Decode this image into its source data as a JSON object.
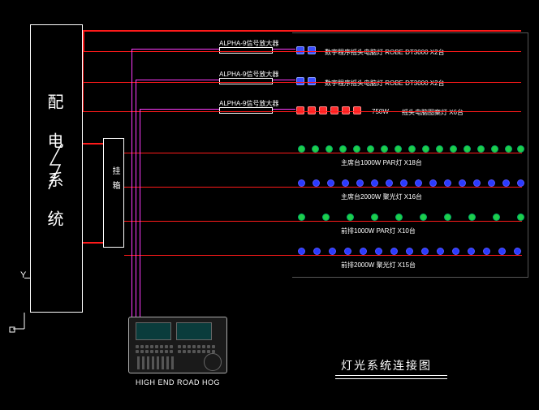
{
  "title": "灯光系统连接图",
  "power_box": {
    "label": "配电系统"
  },
  "wall_box": {
    "label": "挂箱"
  },
  "ground_symbol": "Y",
  "console": {
    "label": "HIGH END  ROAD HOG"
  },
  "amplifiers": [
    {
      "label": "ALPHA-9信号放大器"
    },
    {
      "label": "ALPHA-9信号放大器"
    },
    {
      "label": "ALPHA-9信号放大器"
    }
  ],
  "fixture_rows": [
    {
      "label": "数字程序摇头电脑灯 ROBE DT3000 X2台"
    },
    {
      "label": "数字程序摇头电脑灯 ROBE DT3000 X2台"
    },
    {
      "label_left": "750W",
      "label_right": "摇头电脑图案灯  X6台"
    },
    {
      "label": "主席台1000W PAR灯  X18台"
    },
    {
      "label": "主席台2000W 聚光灯  X16台"
    },
    {
      "label": "前排1000W PAR灯  X10台"
    },
    {
      "label": "前排2000W 聚光灯  X15台"
    }
  ]
}
